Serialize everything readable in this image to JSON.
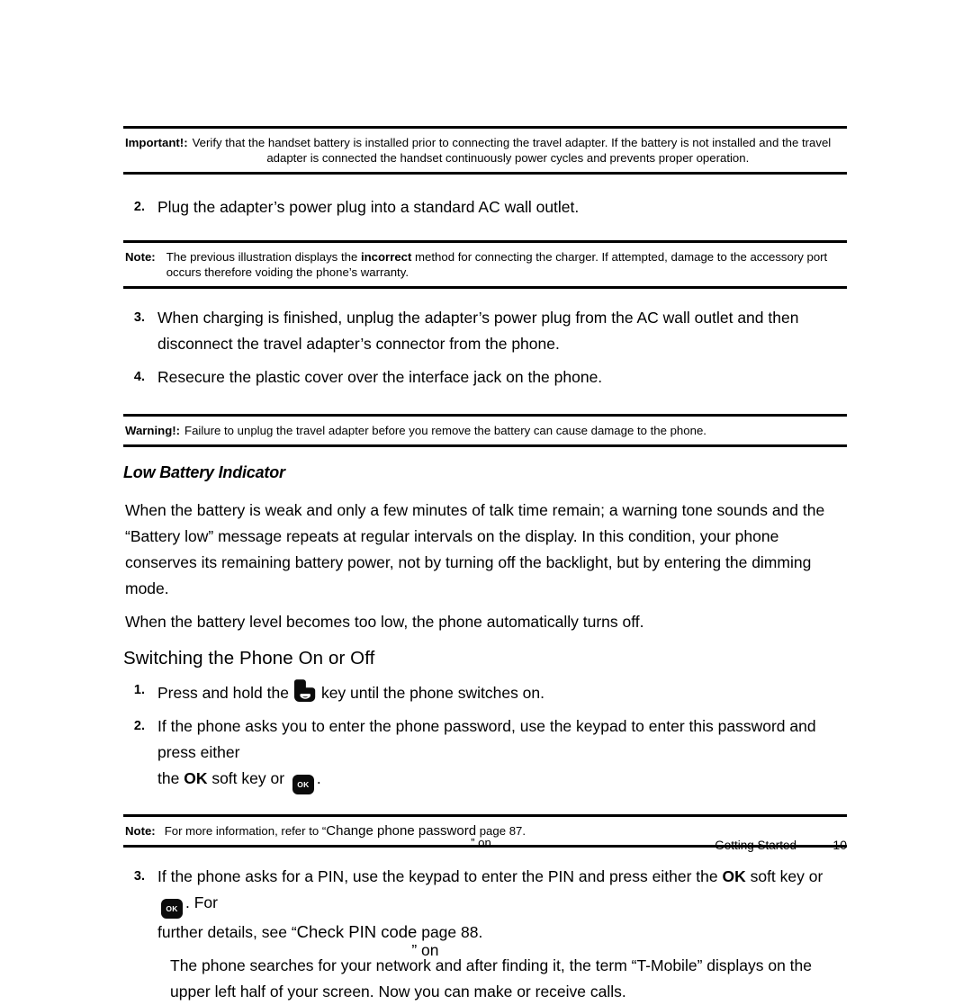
{
  "document": {
    "footer": {
      "chapter": "Getting Started",
      "page_number": "10"
    }
  },
  "blocks": {
    "important_1": {
      "label": "Important!:",
      "line1": "Verify that the handset battery is installed prior to connecting the travel adapter. If the battery is not installed and the travel",
      "line2": "adapter is connected the handset continuously power cycles and prevents proper operation."
    },
    "step_2": {
      "number": "2.",
      "text": "Plug the adapter’s power plug into a standard AC wall outlet."
    },
    "note_1": {
      "label": "Note:",
      "text_before": "The previous illustration displays the ",
      "emphasis": "incorrect",
      "text_after": " method for connecting the charger. If attempted, damage to the accessory port occurs therefore voiding the phone’s warranty."
    },
    "step_3": {
      "number": "3.",
      "text": "When charging is finished, unplug the adapter’s power plug from the AC wall outlet and then disconnect the travel adapter’s connector from the phone."
    },
    "step_4": {
      "number": "4.",
      "text": "Resecure the plastic cover over the interface jack on the phone."
    },
    "warning_1": {
      "label": "Warning!:",
      "text": "Failure to unplug the travel adapter before you remove the battery can cause damage to the phone."
    },
    "low_battery_heading": "Low Battery Indicator",
    "low_battery_para_1": "When the battery is weak and only a few minutes of talk time remain; a warning tone sounds and the “Battery low” message repeats at regular intervals on the display. In this condition, your phone conserves its remaining battery power, not by turning off the backlight, but by entering the dimming mode.",
    "low_battery_para_2": "When the battery level becomes too low, the phone automatically turns off.",
    "switching_heading": "Switching the Phone On or Off",
    "switch_step_1": {
      "number": "1.",
      "text_before": "Press and hold the",
      "icon_label": "power-key",
      "text_after": "key until the phone switches on."
    },
    "switch_step_2": {
      "number": "2.",
      "text_line1": "If the phone asks you to enter the phone password, use the keypad to enter this password and press either",
      "text_line2_before": "the ",
      "text_line2_bold": "OK",
      "text_line2_mid": " soft key or ",
      "icon_label": "OK",
      "text_line2_after": "."
    },
    "note_2": {
      "label": "Note:",
      "text_before": "For more information, refer to “",
      "reference": "Change phone password",
      "overlap_b": "” on",
      "text_after": " page 87."
    },
    "switch_step_3": {
      "number": "3.",
      "line1_before": "If the phone asks for a PIN, use the keypad to enter the PIN and press either the ",
      "line1_bold": "OK",
      "line1_mid": " soft key or ",
      "icon_label": "OK",
      "line1_after": ". For",
      "line2_before": "further details, see “",
      "line2_reference": "Check PIN code",
      "line2_overlap": "” on",
      "line2_after": " page 88."
    },
    "final_para": "The phone searches for your network and after finding it, the term “T-Mobile” displays on the upper left half of your screen. Now you can make or receive calls."
  }
}
